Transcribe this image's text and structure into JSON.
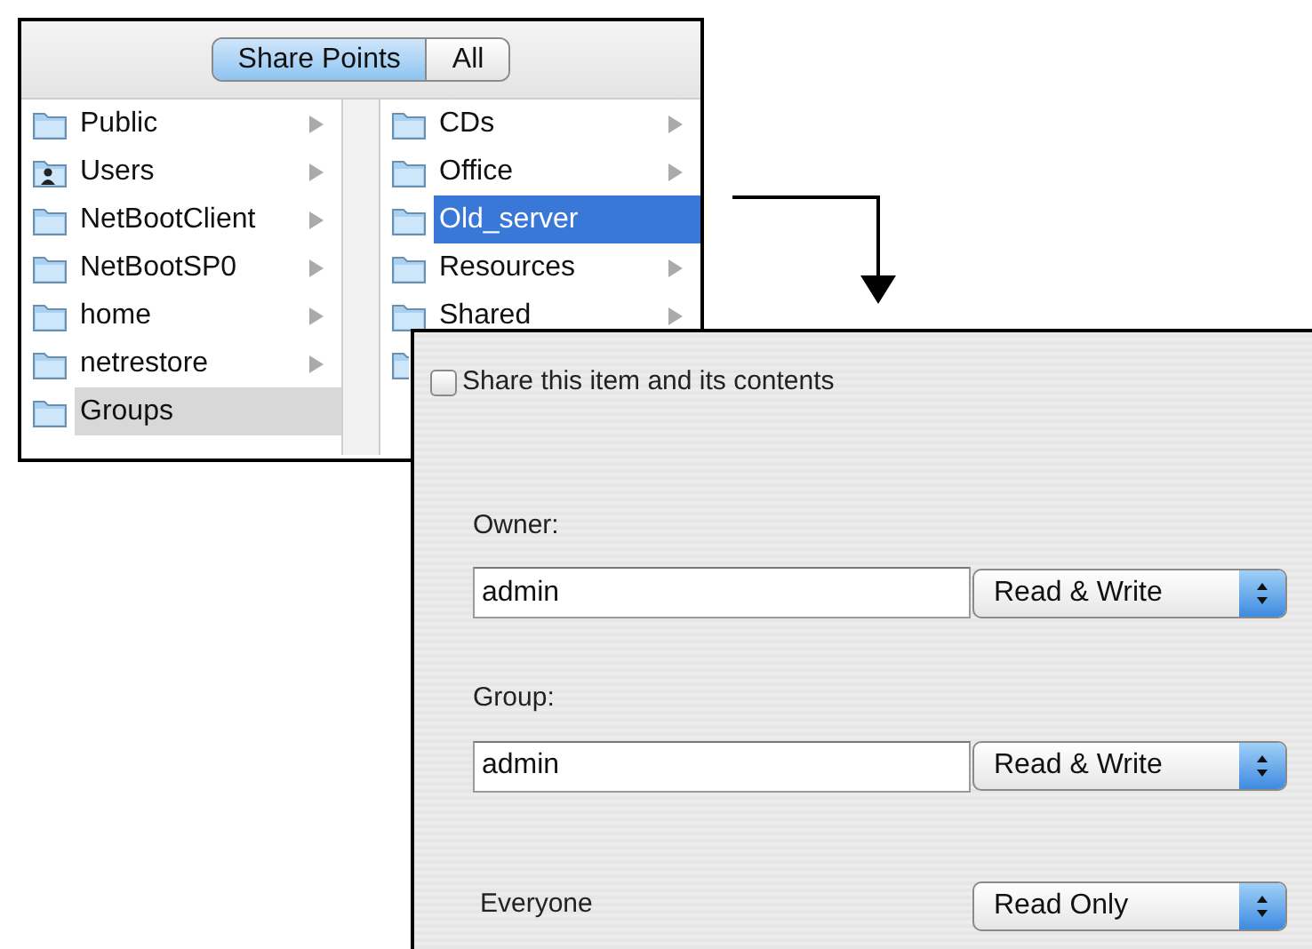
{
  "browser": {
    "segments": [
      {
        "label": "Share Points",
        "selected": true
      },
      {
        "label": "All",
        "selected": false
      }
    ],
    "columns": [
      {
        "items": [
          {
            "label": "Public",
            "kind": "folder",
            "has_children": true,
            "selected": false
          },
          {
            "label": "Users",
            "kind": "user-folder",
            "has_children": true,
            "selected": false
          },
          {
            "label": "NetBootClient",
            "kind": "folder",
            "has_children": true,
            "selected": false
          },
          {
            "label": "NetBootSP0",
            "kind": "folder",
            "has_children": true,
            "selected": false
          },
          {
            "label": "home",
            "kind": "folder",
            "has_children": true,
            "selected": false
          },
          {
            "label": "netrestore",
            "kind": "folder",
            "has_children": true,
            "selected": false
          },
          {
            "label": "Groups",
            "kind": "folder",
            "has_children": false,
            "selected": true
          }
        ]
      },
      {
        "items": [
          {
            "label": "CDs",
            "kind": "folder",
            "has_children": true,
            "selected": false
          },
          {
            "label": "Office",
            "kind": "folder",
            "has_children": true,
            "selected": false
          },
          {
            "label": "Old_server",
            "kind": "folder",
            "has_children": false,
            "selected": true
          },
          {
            "label": "Resources",
            "kind": "folder",
            "has_children": true,
            "selected": false
          },
          {
            "label": "Shared",
            "kind": "folder",
            "has_children": true,
            "selected": false
          },
          {
            "kind": "folder",
            "selected": false
          }
        ]
      }
    ]
  },
  "panel": {
    "share_checkbox": {
      "label": "Share this item and its contents",
      "checked": false
    },
    "permissions": [
      {
        "label": "Owner:",
        "value": "admin",
        "access": "Read & Write"
      },
      {
        "label": "Group:",
        "value": "admin",
        "access": "Read & Write"
      },
      {
        "label": "Everyone",
        "access": "Read Only"
      }
    ]
  }
}
